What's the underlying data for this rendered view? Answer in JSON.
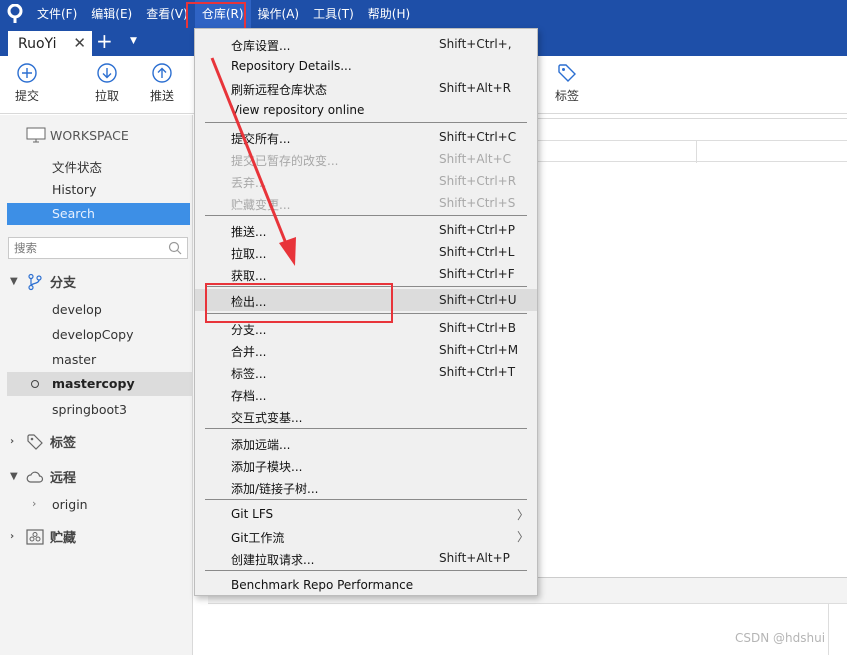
{
  "menubar": {
    "items": [
      "文件(F)",
      "编辑(E)",
      "查看(V)",
      "仓库(R)",
      "操作(A)",
      "工具(T)",
      "帮助(H)"
    ],
    "active_index": 3
  },
  "tabs": {
    "current": "RuoYi",
    "close_glyph": "✕",
    "add_glyph": "+",
    "dropdown_glyph": "▼"
  },
  "toolbar": {
    "commit": "提交",
    "pull": "拉取",
    "push": "推送",
    "tag": "标签"
  },
  "sidebar": {
    "workspace": "WORKSPACE",
    "file_status": "文件状态",
    "history": "History",
    "search": "Search",
    "search_placeholder": "搜索",
    "branches_label": "分支",
    "branches": [
      "develop",
      "developCopy",
      "master",
      "mastercopy",
      "springboot3"
    ],
    "current_branch": "mastercopy",
    "tags_label": "标签",
    "remotes_label": "远程",
    "remote_origin": "origin",
    "stashes_label": "贮藏"
  },
  "dropdown": {
    "items": [
      {
        "label": "仓库设置...",
        "shortcut": "Shift+Ctrl+,",
        "disabled": false
      },
      {
        "label": "Repository Details...",
        "shortcut": "",
        "disabled": false
      },
      {
        "label": "刷新远程仓库状态",
        "shortcut": "Shift+Alt+R",
        "disabled": false
      },
      {
        "label": "View repository online",
        "shortcut": "",
        "disabled": false
      },
      {
        "label": "提交所有...",
        "shortcut": "Shift+Ctrl+C",
        "disabled": false
      },
      {
        "label": "提交已暂存的改变...",
        "shortcut": "Shift+Alt+C",
        "disabled": true
      },
      {
        "label": "丢弃...",
        "shortcut": "Shift+Ctrl+R",
        "disabled": true
      },
      {
        "label": "贮藏变更...",
        "shortcut": "Shift+Ctrl+S",
        "disabled": true
      },
      {
        "label": "推送...",
        "shortcut": "Shift+Ctrl+P",
        "disabled": false
      },
      {
        "label": "拉取...",
        "shortcut": "Shift+Ctrl+L",
        "disabled": false
      },
      {
        "label": "获取...",
        "shortcut": "Shift+Ctrl+F",
        "disabled": false
      },
      {
        "label": "检出...",
        "shortcut": "Shift+Ctrl+U",
        "disabled": false
      },
      {
        "label": "分支...",
        "shortcut": "Shift+Ctrl+B",
        "disabled": false
      },
      {
        "label": "合并...",
        "shortcut": "Shift+Ctrl+M",
        "disabled": false
      },
      {
        "label": "标签...",
        "shortcut": "Shift+Ctrl+T",
        "disabled": false
      },
      {
        "label": "存档...",
        "shortcut": "",
        "disabled": false
      },
      {
        "label": "交互式变基...",
        "shortcut": "",
        "disabled": false
      },
      {
        "label": "添加远端...",
        "shortcut": "",
        "disabled": false
      },
      {
        "label": "添加子模块...",
        "shortcut": "",
        "disabled": false
      },
      {
        "label": "添加/链接子树...",
        "shortcut": "",
        "disabled": false
      },
      {
        "label": "Git LFS",
        "shortcut": "",
        "disabled": false
      },
      {
        "label": "Git工作流",
        "shortcut": "",
        "disabled": false
      },
      {
        "label": "创建拉取请求...",
        "shortcut": "Shift+Alt+P",
        "disabled": false
      },
      {
        "label": "Benchmark Repo Performance",
        "shortcut": "",
        "disabled": false
      }
    ],
    "submenu_glyph": "〉"
  },
  "watermark": "CSDN @hdshui",
  "colors": {
    "titlebar": "#1e4fa8",
    "accent": "#3d8fe6",
    "highlight_box": "#e8343a"
  }
}
